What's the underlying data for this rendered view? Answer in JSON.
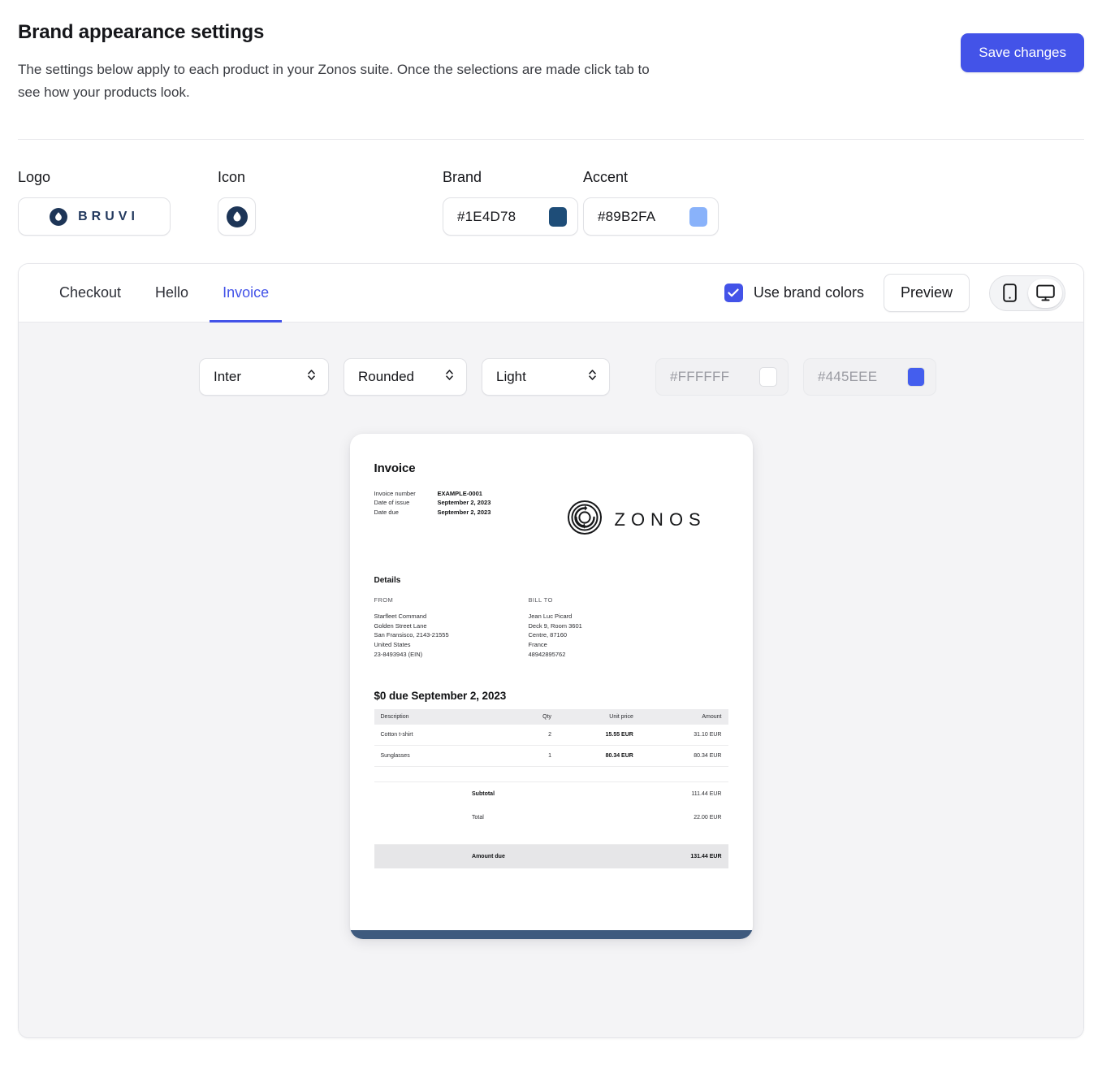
{
  "header": {
    "title": "Brand appearance settings",
    "subtitle": "The settings below apply to each product in your Zonos suite. Once the selections are made click tab to see how your products look.",
    "save_label": "Save changes",
    "save_color": "#4353E8"
  },
  "assets": {
    "logo_label": "Logo",
    "logo_wordmark": "BRUVI",
    "icon_label": "Icon",
    "brand_label": "Brand",
    "brand_value": "#1E4D78",
    "accent_label": "Accent",
    "accent_value": "#89B2FA"
  },
  "panel": {
    "tabs": [
      {
        "label": "Checkout",
        "active": false
      },
      {
        "label": "Hello",
        "active": false
      },
      {
        "label": "Invoice",
        "active": true
      }
    ],
    "use_brand_colors_label": "Use brand colors",
    "use_brand_colors_checked": true,
    "preview_label": "Preview",
    "devices": [
      {
        "name": "mobile",
        "active": false
      },
      {
        "name": "desktop",
        "active": true
      }
    ]
  },
  "controls": {
    "font": "Inter",
    "corners": "Rounded",
    "theme": "Light",
    "background_color": "#FFFFFF",
    "text_color": "#445EEE"
  },
  "invoice": {
    "title": "Invoice",
    "meta": [
      {
        "key": "Invoice number",
        "value": "EXAMPLE-0001"
      },
      {
        "key": "Date of issue",
        "value": "September 2, 2023"
      },
      {
        "key": "Date due",
        "value": "September 2, 2023"
      }
    ],
    "brand_wordmark": "ZONOS",
    "details_title": "Details",
    "from_heading": "FROM",
    "from_lines": [
      "Starfleet Command",
      "Golden Street Lane",
      "San Fransisco, 2143-21555",
      "United States",
      "23-8493943 (EIN)"
    ],
    "bill_to_heading": "BILL TO",
    "bill_to_lines": [
      "Jean Luc Picard",
      "Deck 9, Room 3601",
      "Centre, 87160",
      "France",
      "48942895762"
    ],
    "due_title": "$0 due September 2, 2023",
    "table": {
      "columns": [
        "Description",
        "Qty",
        "Unit price",
        "Amount"
      ],
      "rows": [
        {
          "description": "Cotton t-shirt",
          "qty": "2",
          "unit_price": "15.55 EUR",
          "amount": "31.10 EUR"
        },
        {
          "description": "Sunglasses",
          "qty": "1",
          "unit_price": "80.34 EUR",
          "amount": "80.34 EUR"
        }
      ],
      "totals": [
        {
          "label": "Subtotal",
          "value": "111.44 EUR",
          "strong": true
        },
        {
          "label": "Total",
          "value": "22.00 EUR",
          "strong": false
        }
      ],
      "amount_due_label": "Amount due",
      "amount_due_value": "131.44 EUR"
    },
    "footer_bar_color": "#3E5A7E"
  }
}
